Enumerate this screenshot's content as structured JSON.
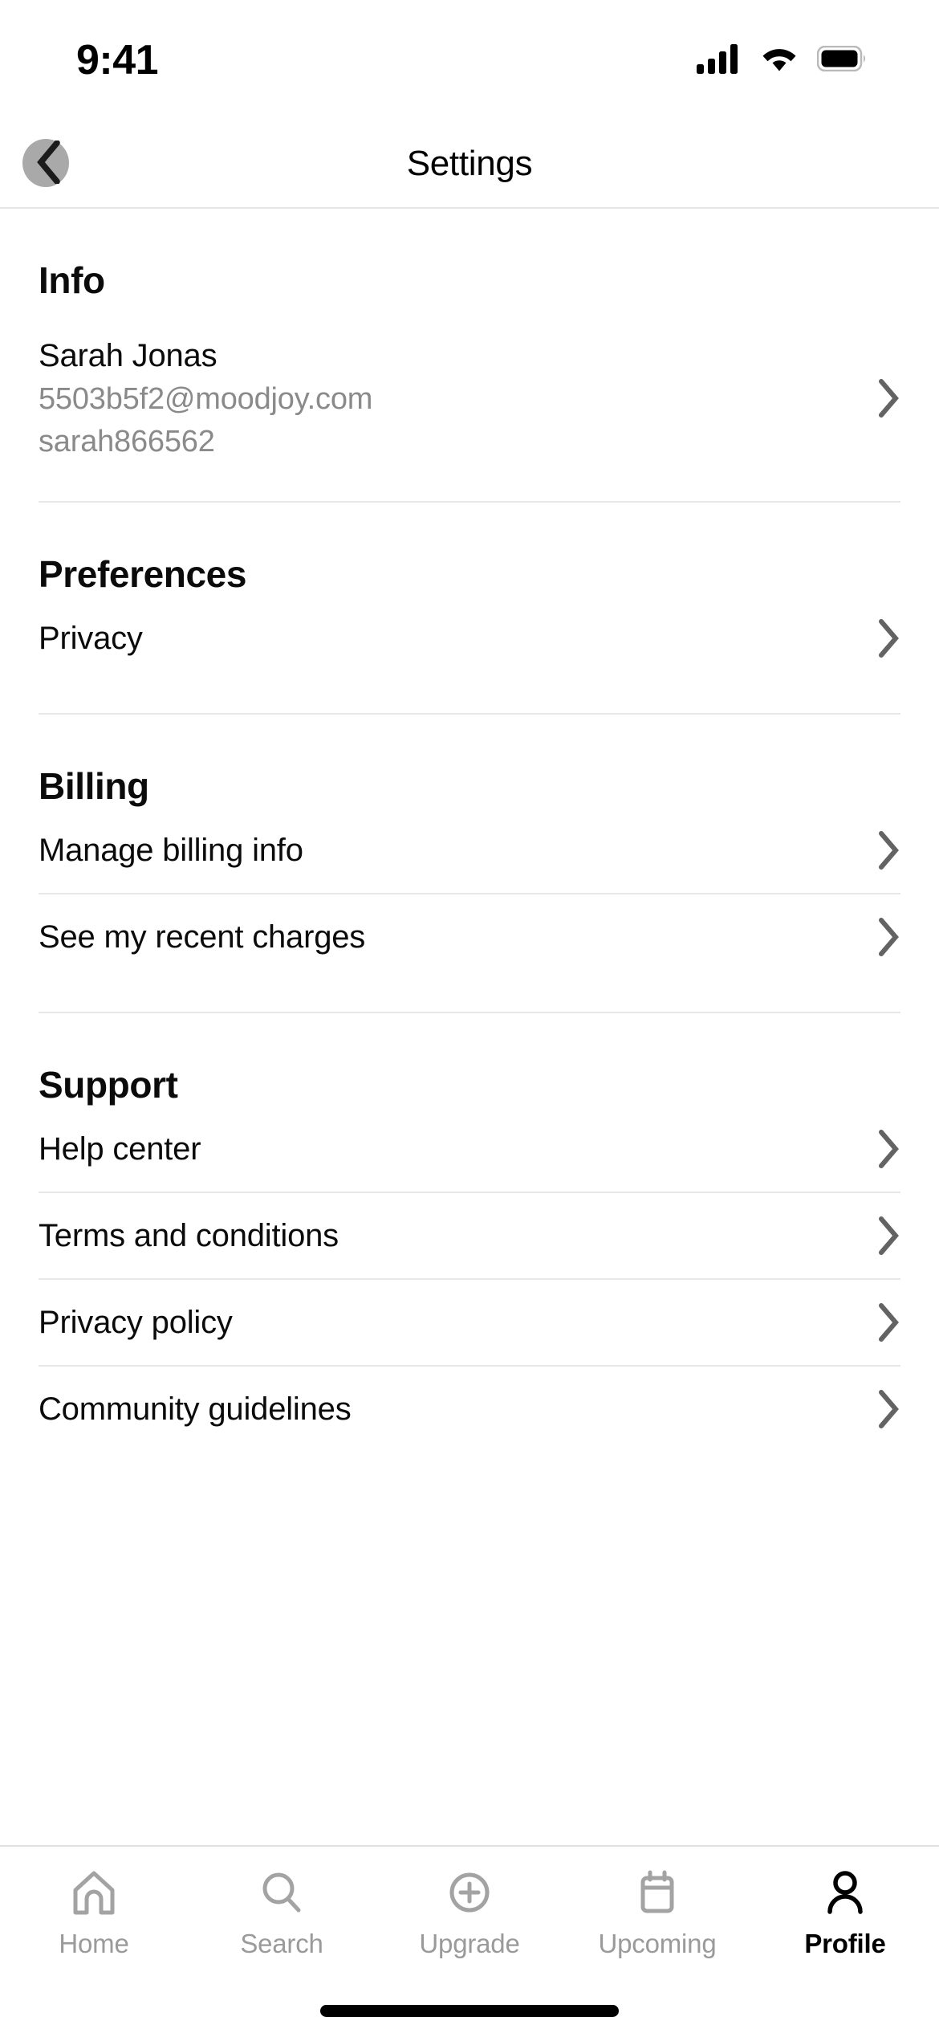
{
  "status_bar": {
    "time": "9:41",
    "cellular_icon": "cellular-signal-icon",
    "wifi_icon": "wifi-icon",
    "battery_icon": "battery-full-icon"
  },
  "header": {
    "title": "Settings",
    "back_icon": "chevron-left-icon",
    "back_circle_color": "#a9a9a9"
  },
  "sections": [
    {
      "title": "Info",
      "items": [
        {
          "type": "profile",
          "name": "Sarah Jonas",
          "email": "5503b5f2@moodjoy.com",
          "username": "sarah866562",
          "chevron": "chevron-right-icon"
        }
      ]
    },
    {
      "title": "Preferences",
      "items": [
        {
          "type": "link",
          "label": "Privacy",
          "chevron": "chevron-right-icon"
        }
      ]
    },
    {
      "title": "Billing",
      "items": [
        {
          "type": "link",
          "label": "Manage billing info",
          "chevron": "chevron-right-icon"
        },
        {
          "type": "link",
          "label": "See my recent charges",
          "chevron": "chevron-right-icon"
        }
      ]
    },
    {
      "title": "Support",
      "items": [
        {
          "type": "link",
          "label": "Help center",
          "chevron": "chevron-right-icon"
        },
        {
          "type": "link",
          "label": "Terms and conditions",
          "chevron": "chevron-right-icon"
        },
        {
          "type": "link",
          "label": "Privacy policy",
          "chevron": "chevron-right-icon"
        },
        {
          "type": "link",
          "label": "Community guidelines",
          "chevron": "chevron-right-icon"
        }
      ]
    }
  ],
  "tab_bar": {
    "tabs": [
      {
        "label": "Home",
        "icon": "home-icon",
        "active": false
      },
      {
        "label": "Search",
        "icon": "search-icon",
        "active": false
      },
      {
        "label": "Upgrade",
        "icon": "plus-circle-icon",
        "active": false
      },
      {
        "label": "Upcoming",
        "icon": "calendar-icon",
        "active": false
      },
      {
        "label": "Profile",
        "icon": "person-icon",
        "active": true
      }
    ],
    "inactive_color": "#9a9a9a",
    "active_color": "#000000"
  },
  "colors": {
    "background": "#ffffff",
    "primary_text": "#0b0b0b",
    "secondary_text": "#8a8a8a",
    "divider": "#e8e8e8",
    "chevron": "#636363"
  }
}
